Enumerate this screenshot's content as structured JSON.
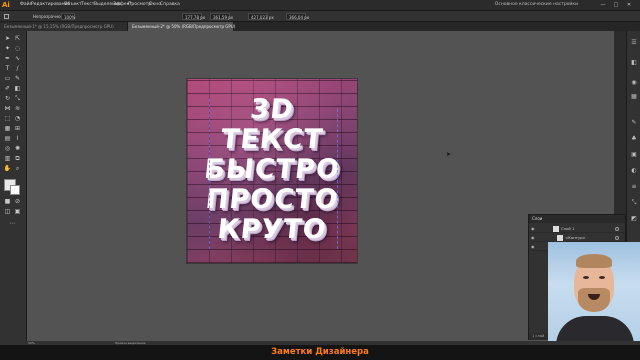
{
  "app": {
    "logo": "Ai",
    "workspace": "Основное классические настройки"
  },
  "menu": [
    "Файл",
    "Редактирование",
    "Объект",
    "Текст",
    "Выделение",
    "Эффект",
    "Просмотр",
    "Окно",
    "Справка"
  ],
  "window_controls": [
    "—",
    "□",
    "✕"
  ],
  "control_bar": {
    "opacity_label": "Непрозрачность:",
    "opacity_value": "100%",
    "x_value": "177,78 px",
    "y_value": "361,59 px",
    "w_value": "427,023 px",
    "h_value": "366,04 px"
  },
  "tabs": [
    {
      "label": "Безымянный-1* @ 15,15% (RGB/Предпросмотр GPU)",
      "active": false
    },
    {
      "label": "Безымянный-2* @ 50% (RGB/Предпросмотр GPU)",
      "active": true
    }
  ],
  "artwork": {
    "lines": [
      "3D",
      "ТЕКСТ",
      "БЫСТРО",
      "ПРОСТО",
      "КРУТО"
    ]
  },
  "layers": {
    "title": "Слои",
    "rows": [
      {
        "name": "Слой 1"
      },
      {
        "name": "<Контур>"
      },
      {
        "name": "<Группа обрезки>"
      }
    ],
    "footer": "1 слой"
  },
  "status": {
    "zoom": "50%",
    "info": "Прямое выделение"
  },
  "caption": "Заметки Дизайнера",
  "colors": {
    "accent": "#ff7a1a",
    "canvas": "#535353",
    "chrome": "#323232"
  }
}
